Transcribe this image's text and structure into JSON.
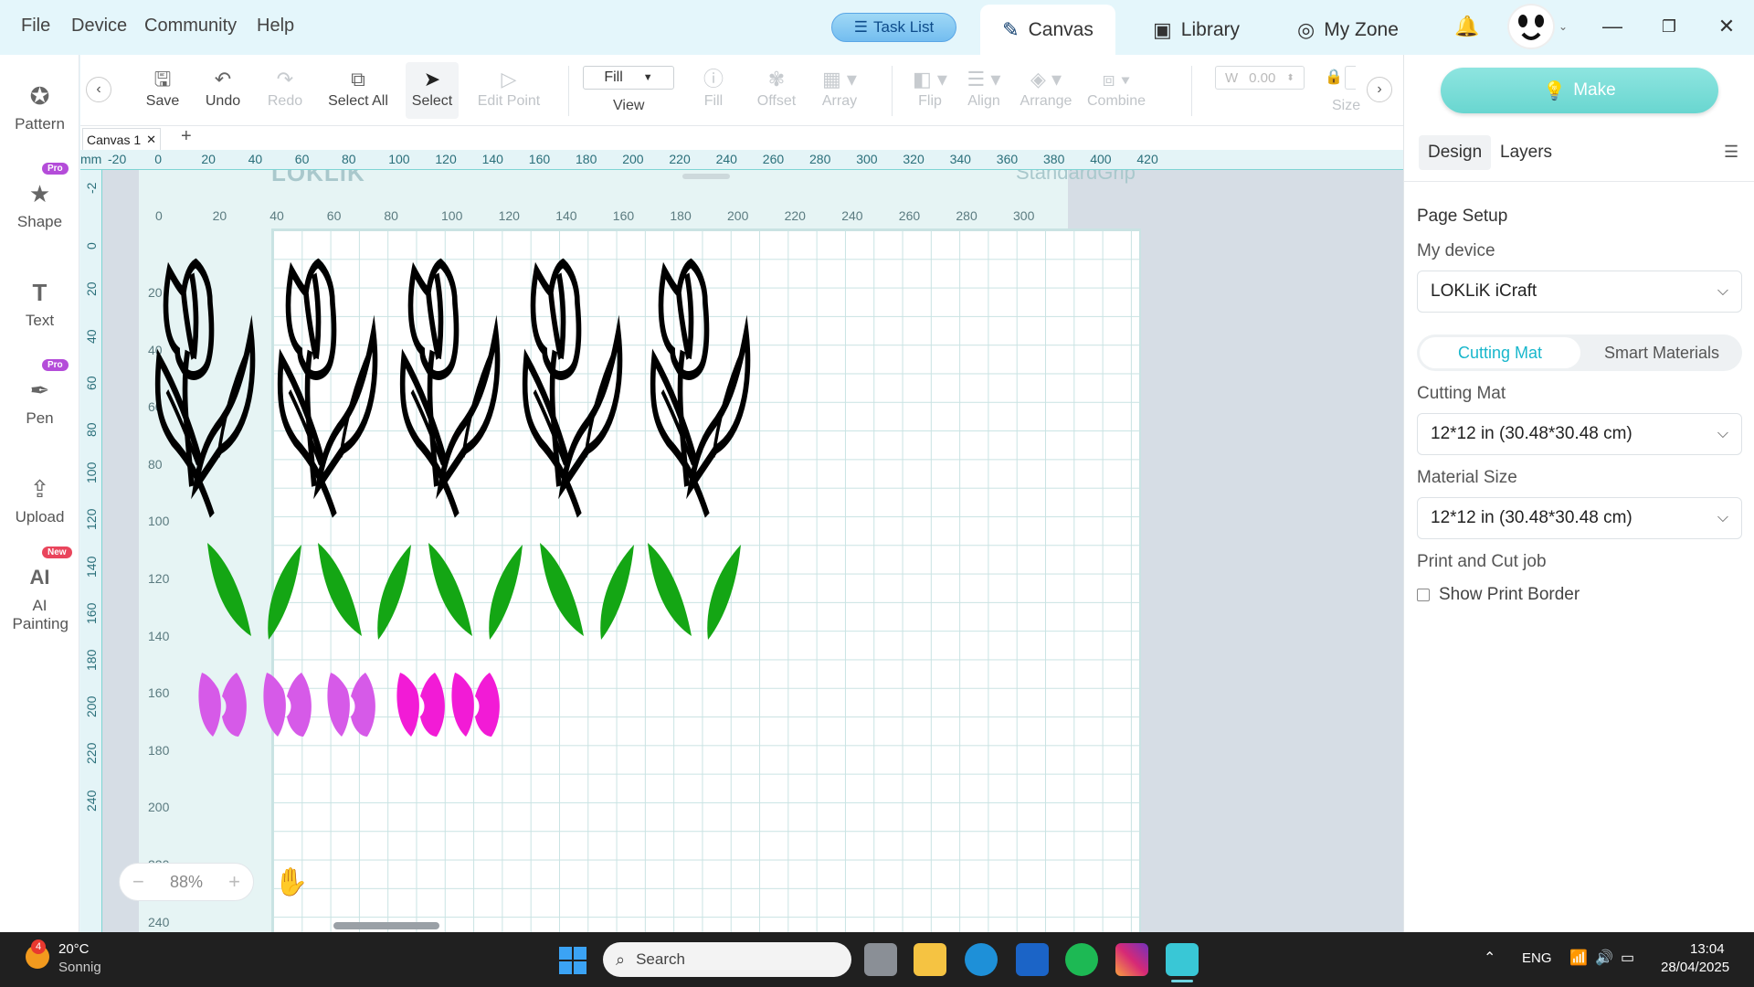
{
  "menu": [
    "File",
    "Device",
    "Community",
    "Help"
  ],
  "task_list": "Task List",
  "tabs": {
    "canvas": "Canvas",
    "library": "Library",
    "myzone": "My Zone"
  },
  "sidebar": [
    {
      "label": "Pattern"
    },
    {
      "label": "Shape",
      "badge": "Pro"
    },
    {
      "label": "Text"
    },
    {
      "label": "Pen",
      "badge": "Pro"
    },
    {
      "label": "Upload"
    },
    {
      "label": "AI Painting",
      "badge": "New"
    }
  ],
  "toolbar": {
    "save": "Save",
    "undo": "Undo",
    "redo": "Redo",
    "select_all": "Select All",
    "select": "Select",
    "edit_point": "Edit Point",
    "view_value": "Fill",
    "view": "View",
    "fill": "Fill",
    "offset": "Offset",
    "array": "Array",
    "flip": "Flip",
    "align": "Align",
    "arrange": "Arrange",
    "combine": "Combine",
    "width_label": "W",
    "width_value": "0.00",
    "size": "Size"
  },
  "doc_tab": "Canvas 1",
  "ruler_unit": "mm",
  "ruler_top": [
    "-20",
    "0",
    "20",
    "40",
    "60",
    "80",
    "100",
    "120",
    "140",
    "160",
    "180",
    "200",
    "220",
    "240",
    "260",
    "280",
    "300",
    "320",
    "340",
    "360",
    "380",
    "400",
    "420"
  ],
  "ruler_left": [
    "-2",
    "0",
    "20",
    "40",
    "60",
    "80",
    "100",
    "120",
    "140",
    "160",
    "180",
    "200",
    "220",
    "240"
  ],
  "mat_top": [
    "0",
    "20",
    "40",
    "60",
    "80",
    "100",
    "120",
    "140",
    "160",
    "180",
    "200",
    "220",
    "240",
    "260",
    "280",
    "300"
  ],
  "mat_left": [
    "20",
    "40",
    "60",
    "80",
    "100",
    "120",
    "140",
    "160",
    "180",
    "200",
    "220",
    "240"
  ],
  "mat_brand": "LOKLiK",
  "mat_type": "StandardGrip",
  "zoom": "88%",
  "panel": {
    "make": "Make",
    "design_tab": "Design",
    "layers_tab": "Layers",
    "page_setup": "Page Setup",
    "my_device": "My device",
    "device_value": "LOKLiK iCraft",
    "seg_cutting": "Cutting Mat",
    "seg_smart": "Smart Materials",
    "cutting_mat_label": "Cutting Mat",
    "cutting_mat_value": "12*12 in (30.48*30.48 cm)",
    "material_size_label": "Material Size",
    "material_size_value": "12*12 in (30.48*30.48 cm)",
    "print_cut_label": "Print and Cut job",
    "show_print_border": "Show Print Border"
  },
  "taskbar": {
    "weather_temp": "20°C",
    "weather_desc": "Sonnig",
    "weather_badge": "4",
    "search": "Search",
    "lang": "ENG",
    "time": "13:04",
    "date": "28/04/2025"
  },
  "colors": {
    "accent": "#19b7cc",
    "make": "#6fd8d2",
    "leaf": "#14a614",
    "petal_light": "#d65ae8",
    "petal_dark": "#f21bd6"
  }
}
